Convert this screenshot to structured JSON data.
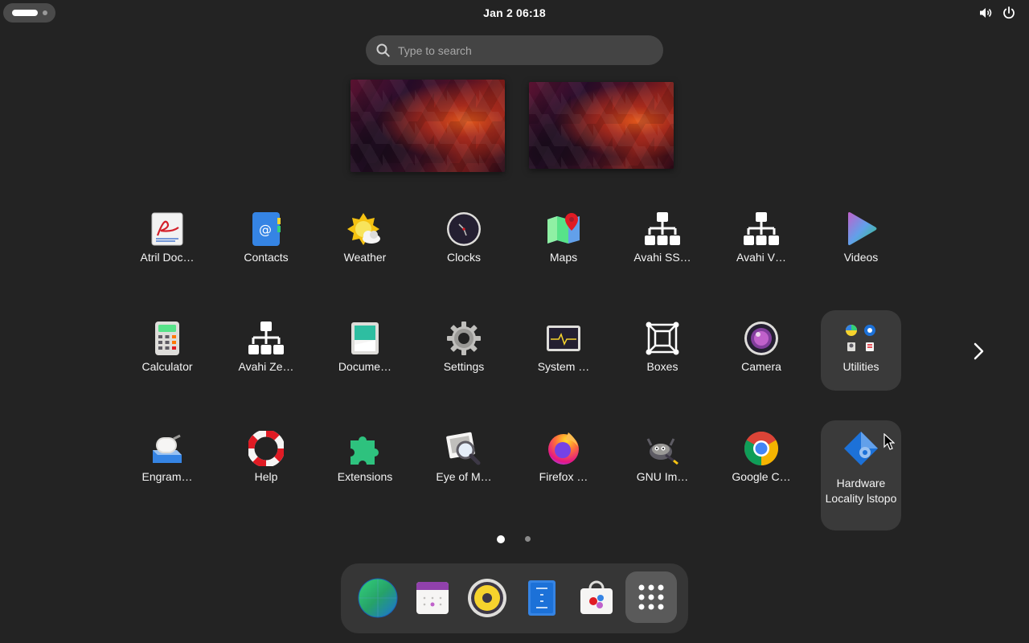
{
  "topbar": {
    "clock": "Jan 2  06:18",
    "icons": [
      "activities-indicator",
      "volume-icon",
      "power-icon"
    ]
  },
  "search": {
    "placeholder": "Type to search",
    "value": ""
  },
  "workspaces": [
    "workspace-1",
    "workspace-2"
  ],
  "apps": [
    {
      "label": "Atril Doc…",
      "icon": "atril-icon"
    },
    {
      "label": "Contacts",
      "icon": "contacts-icon"
    },
    {
      "label": "Weather",
      "icon": "weather-icon"
    },
    {
      "label": "Clocks",
      "icon": "clocks-icon"
    },
    {
      "label": "Maps",
      "icon": "maps-icon"
    },
    {
      "label": "Avahi SS…",
      "icon": "network-icon"
    },
    {
      "label": "Avahi V…",
      "icon": "network-icon"
    },
    {
      "label": "Videos",
      "icon": "videos-icon"
    },
    {
      "label": "Calculator",
      "icon": "calculator-icon"
    },
    {
      "label": "Avahi Ze…",
      "icon": "network-icon"
    },
    {
      "label": "Docume…",
      "icon": "document-scanner-icon"
    },
    {
      "label": "Settings",
      "icon": "settings-icon"
    },
    {
      "label": "System …",
      "icon": "system-monitor-icon"
    },
    {
      "label": "Boxes",
      "icon": "boxes-icon"
    },
    {
      "label": "Camera",
      "icon": "camera-icon"
    },
    {
      "label": "Utilities",
      "icon": "folder-icon"
    },
    {
      "label": "Engram…",
      "icon": "engrampa-icon"
    },
    {
      "label": "Help",
      "icon": "help-icon"
    },
    {
      "label": "Extensions",
      "icon": "extensions-icon"
    },
    {
      "label": "Eye of M…",
      "icon": "image-viewer-icon"
    },
    {
      "label": "Firefox …",
      "icon": "firefox-icon"
    },
    {
      "label": "GNU Im…",
      "icon": "gimp-icon"
    },
    {
      "label": "Google C…",
      "icon": "chrome-icon"
    },
    {
      "label": "Hardware Locality lstopo",
      "icon": "hwloc-icon"
    }
  ],
  "pagination": {
    "pages": 2,
    "current": 1
  },
  "dock": [
    "web-browser-icon",
    "calendar-icon",
    "rhythmbox-icon",
    "text-editor-icon",
    "software-icon",
    "show-apps-icon"
  ],
  "colors": {
    "background": "#232323",
    "highlight": "#3a3a3a",
    "dock": "#363636"
  }
}
